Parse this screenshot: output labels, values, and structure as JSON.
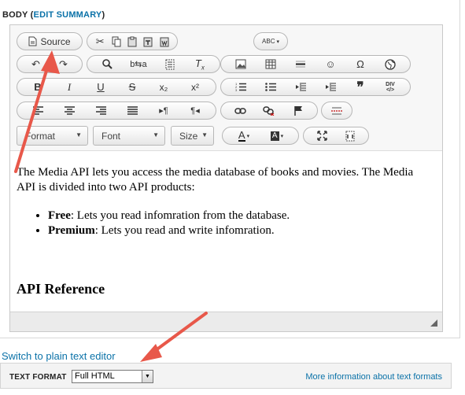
{
  "field": {
    "label": "BODY",
    "edit_summary": "EDIT SUMMARY"
  },
  "toolbar": {
    "source_label": "Source",
    "format_combo": "Format",
    "font_combo": "Font",
    "size_combo": "Size",
    "icons": {
      "source": "document-source-icon",
      "cut": "scissors-icon",
      "copy": "copy-icon",
      "paste": "paste-icon",
      "paste_text": "paste-text-icon",
      "paste_word": "paste-word-icon",
      "spellcheck": "spellcheck-icon",
      "undo": "undo-icon",
      "redo": "redo-icon",
      "find": "magnifier-icon",
      "replace": "find-replace-icon",
      "select_all": "select-all-icon",
      "remove_format": "remove-format-icon",
      "image": "image-icon",
      "table": "table-icon",
      "hr": "horizontal-rule-icon",
      "smiley": "smiley-icon",
      "special_char": "omega-icon",
      "iframe": "globe-icon",
      "bold": "bold-icon",
      "italic": "italic-icon",
      "underline": "underline-icon",
      "strike": "strikethrough-icon",
      "subscript": "subscript-icon",
      "superscript": "superscript-icon",
      "numbered_list": "numbered-list-icon",
      "bulleted_list": "bulleted-list-icon",
      "outdent": "outdent-icon",
      "indent": "indent-icon",
      "blockquote": "blockquote-icon",
      "div": "div-container-icon",
      "align_left": "align-left-icon",
      "align_center": "align-center-icon",
      "align_right": "align-right-icon",
      "justify": "justify-icon",
      "ltr": "text-direction-ltr-icon",
      "rtl": "text-direction-rtl-icon",
      "link": "link-icon",
      "unlink": "unlink-icon",
      "anchor": "flag-anchor-icon",
      "page_break": "page-break-icon",
      "text_color": "text-color-icon",
      "bg_color": "background-color-icon",
      "maximize": "maximize-icon",
      "show_blocks": "show-blocks-icon"
    },
    "glyphs": {
      "bold": "B",
      "italic": "I",
      "underline": "U",
      "strike": "S",
      "subscript": "x₂",
      "superscript": "x²",
      "blockquote": "❞",
      "special_char": "Ω",
      "text_color": "A",
      "bg_color": "A",
      "abc": "ABC",
      "div": "DIV"
    }
  },
  "content": {
    "paragraph": "The Media API lets you access the media database of books and movies. The Media API is divided into two API products:",
    "bullets": [
      {
        "term": "Free",
        "text": ": Lets you read infomration from the database."
      },
      {
        "term": "Premium",
        "text": ": Lets you read and write infomration."
      }
    ],
    "heading": "API Reference"
  },
  "switch_link": "Switch to plain text editor",
  "text_format": {
    "label": "TEXT FORMAT",
    "selected": "Full HTML",
    "more_info": "More information about text formats"
  },
  "colors": {
    "link": "#0b72a8",
    "annotation_arrow": "#e8584a"
  }
}
